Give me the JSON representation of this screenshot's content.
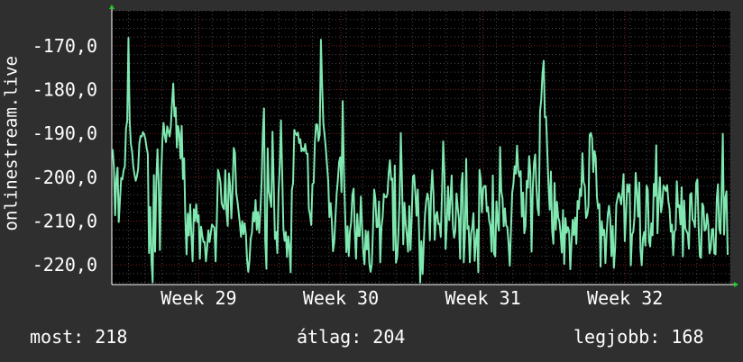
{
  "chart_data": {
    "type": "line",
    "ylabel": "onlinestream.live",
    "y_ticks": [
      -170,
      -180,
      -190,
      -200,
      -210,
      -220
    ],
    "y_tick_labels": [
      "-170,0",
      "-180,0",
      "-190,0",
      "-200,0",
      "-210,0",
      "-220,0"
    ],
    "ylim": [
      -224.5,
      -162
    ],
    "grid": true,
    "x_ticks": [
      {
        "label": "Week 29",
        "at": 52
      },
      {
        "label": "Week 30",
        "at": 137
      },
      {
        "label": "Week 31",
        "at": 222
      },
      {
        "label": "Week 32",
        "at": 307
      }
    ],
    "xlim": [
      0,
      370
    ],
    "series_color": "#7fe8b0",
    "series": [
      {
        "name": "",
        "values": [
          -193.6,
          -197.8,
          -208.7,
          -200.3,
          -197.8,
          -210.2,
          -205.2,
          -200.2,
          -200.5,
          -198.4,
          -197.6,
          -188.8,
          -187.1,
          -168.2,
          -187.1,
          -192.4,
          -194.1,
          -197.6,
          -199.4,
          -200.8,
          -199.8,
          -198.1,
          -192.3,
          -190.6,
          -190.7,
          -189.7,
          -190.2,
          -191.3,
          -193.3,
          -194.7,
          -217.3,
          -206.8,
          -218.9,
          -224.0,
          -199.5,
          -217.0,
          -200.9,
          -193.6,
          -201.7,
          -216.6,
          -200.1,
          -191.8,
          -187.6,
          -190.4,
          -192.0,
          -188.4,
          -189.4,
          -190.7,
          -188.5,
          -183.0,
          -178.6,
          -186.1,
          -184.1,
          -193.2,
          -188.3,
          -190.0,
          -195.7,
          -188.3,
          -200.4,
          -195.7,
          -209.4,
          -217.6,
          -208.3,
          -213.3,
          -206.2,
          -213.3,
          -219.2,
          -207.3,
          -210.0,
          -206.2,
          -210.2,
          -208.7,
          -218.6,
          -211.3,
          -213.3,
          -214.8,
          -214.8,
          -219.2,
          -216.2,
          -212.1,
          -214.8,
          -212.8,
          -210.8,
          -211.2,
          -211.5,
          -219.2,
          -209.8,
          -198.3,
          -199.5,
          -201.1,
          -205.9,
          -206.8,
          -207.3,
          -198.4,
          -207.8,
          -211.1,
          -199.1,
          -201.9,
          -209.4,
          -202.8,
          -193.3,
          -194.4,
          -203.5,
          -205.4,
          -207.9,
          -210.5,
          -213.6,
          -210.0,
          -213.0,
          -210.5,
          -213.0,
          -218.9,
          -221.6,
          -218.9,
          -214.0,
          -212.7,
          -208.0,
          -210.1,
          -205.2,
          -212.0,
          -207.9,
          -212.7,
          -207.7,
          -200.9,
          -190.1,
          -184.3,
          -214.5,
          -220.9,
          -193.4,
          -203.1,
          -204.9,
          -206.8,
          -189.6,
          -201.6,
          -214.1,
          -212.5,
          -217.3,
          -203.5,
          -197.4,
          -187.0,
          -199.0,
          -211.7,
          -214.5,
          -212.5,
          -218.2,
          -213.5,
          -216.2,
          -221.7,
          -202.9,
          -201.3,
          -189.2,
          -190.0,
          -190.4,
          -189.8,
          -192.2,
          -191.3,
          -194.1,
          -193.4,
          -194.0,
          -192.4,
          -194.6,
          -194.6,
          -207.2,
          -208.6,
          -210.9,
          -201.5,
          -201.3,
          -192.1,
          -187.9,
          -188.0,
          -191.7,
          -190.3,
          -168.6,
          -179.1,
          -187.7,
          -190.3,
          -193.3,
          -197.1,
          -200.8,
          -209.1,
          -205.9,
          -210.0,
          -216.9,
          -214.8,
          -209.2,
          -203.8,
          -200.6,
          -196.5,
          -195.4,
          -203.4,
          -182.6,
          -199.1,
          -208.5,
          -217.1,
          -211.2,
          -218.0,
          -212.3,
          -210.2,
          -204.0,
          -202.6,
          -212.2,
          -218.6,
          -208.4,
          -213.4,
          -213.4,
          -204.4,
          -211.0,
          -217.2,
          -219.9,
          -212.2,
          -216.5,
          -212.4,
          -219.7,
          -221.6,
          -219.9,
          -211.9,
          -202.8,
          -204.9,
          -211.4,
          -211.3,
          -205.5,
          -219.4,
          -211.4,
          -209.1,
          -203.8,
          -204.5,
          -204.6,
          -203.8,
          -198.9,
          -196.1,
          -200.6,
          -200.3,
          -216.7,
          -197.3,
          -219.5,
          -218.2,
          -212.9,
          -204.9,
          -189.9,
          -201.3,
          -215.3,
          -205.8,
          -210.6,
          -213.3,
          -217.0,
          -206.6,
          -216.6,
          -209.0,
          -199.8,
          -199.5,
          -203.6,
          -208.8,
          -202.8,
          -211.8,
          -224.0,
          -214.6,
          -222.1,
          -214.7,
          -208.4,
          -205.4,
          -203.7,
          -205.3,
          -214.4,
          -203.6,
          -198.4,
          -204.0,
          -214.3,
          -208.7,
          -207.9,
          -210.7,
          -210.6,
          -213.6,
          -203.7,
          -191.8,
          -199.1,
          -216.4,
          -210.5,
          -202.1,
          -209.8,
          -204.8,
          -199.6,
          -211.0,
          -213.8,
          -212.3,
          -203.7,
          -206.9,
          -209.5,
          -218.6,
          -201.8,
          -199.0,
          -219.4,
          -212.8,
          -195.8,
          -211.8,
          -211.2,
          -219.4,
          -212.9,
          -211.4,
          -208.2,
          -219.1,
          -214.6,
          -211.9,
          -221.7,
          -198.3,
          -200.3,
          -208.0,
          -202.6,
          -202.0,
          -202.0,
          -207.8,
          -206.8,
          -209.9,
          -211.2,
          -217.0,
          -199.6,
          -217.4,
          -218.1,
          -205.5,
          -210.0,
          -212.2,
          -193.1,
          -203.2,
          -204.8,
          -211.2,
          -207.1,
          -211.0,
          -211.4,
          -215.1,
          -220.2,
          -212.0,
          -203.6,
          -201.5,
          -197.5,
          -199.2,
          -192.8,
          -198.4,
          -199.8,
          -198.6,
          -209.0,
          -203.5,
          -212.8,
          -211.2,
          -200.8,
          -202.4,
          -195.2,
          -199.0,
          -217.0,
          -202.7,
          -196.8,
          -194.8,
          -202.3,
          -207.1,
          -208.7,
          -185.0,
          -182.3,
          -176.5,
          -173.4,
          -186.3,
          -186.2,
          -194.2,
          -201.9,
          -207.4,
          -198.7,
          -212.1,
          -215.2,
          -201.3,
          -212.0,
          -205.6,
          -209.2,
          -210.1,
          -212.9,
          -217.2,
          -207.5,
          -219.8,
          -209.3,
          -212.7,
          -211.4,
          -212.3,
          -221.0,
          -214.9,
          -209.7,
          -213.2,
          -209.2,
          -215.2,
          -205.4,
          -207.2,
          -202.7,
          -204.3,
          -194.5,
          -201.1,
          -202.0,
          -209.3,
          -208.6,
          -206.5,
          -190.3,
          -189.9,
          -191.1,
          -198.8,
          -194.0,
          -195.6,
          -204.5,
          -207.1,
          -206.1,
          -220.4,
          -210.0,
          -213.2,
          -212.0,
          -219.6,
          -212.9,
          -208.5,
          -206.5,
          -209.5,
          -218.0,
          -211.1,
          -220.7,
          -216.3,
          -206.3,
          -204.8,
          -203.6,
          -204.6,
          -206.2,
          -203.4,
          -199.3,
          -214.6,
          -208.7,
          -201.6,
          -203.3,
          -201.6,
          -220.1,
          -213.1,
          -212.5,
          -209.2,
          -199.0,
          -203.3,
          -209.0,
          -201.2,
          -216.6,
          -220.1,
          -214.0,
          -212.5,
          -215.6,
          -201.9,
          -202.9,
          -214.5,
          -215.8,
          -210.5,
          -213.3,
          -201.5,
          -204.3,
          -192.7,
          -212.8,
          -205.3,
          -200.0,
          -208.0,
          -205.8,
          -201.9,
          -202.4,
          -203.1,
          -201.8,
          -205.4,
          -207.2,
          -212.4,
          -210.8,
          -217.8,
          -212.4,
          -212.0,
          -200.9,
          -206.8,
          -206.4,
          -210.8,
          -202.3,
          -218.1,
          -205.3,
          -211.6,
          -212.3,
          -212.9,
          -216.3,
          -204.0,
          -203.6,
          -209.7,
          -210.0,
          -211.4,
          -201.3,
          -200.5,
          -211.3,
          -218.1,
          -218.4,
          -206.0,
          -206.7,
          -212.2,
          -211.8,
          -208.4,
          -210.8,
          -217.4,
          -216.3,
          -211.9,
          -211.8,
          -217.4,
          -217.6,
          -204.9,
          -201.6,
          -211.6,
          -212.9,
          -203.2,
          -190.1,
          -213.1,
          -204.9,
          -203.2,
          -217.7
        ]
      }
    ]
  },
  "stats": {
    "now_label": "most:",
    "now_value": "218",
    "avg_label": "átlag:",
    "avg_value": "204",
    "best_label": "legjobb:",
    "best_value": "168"
  }
}
